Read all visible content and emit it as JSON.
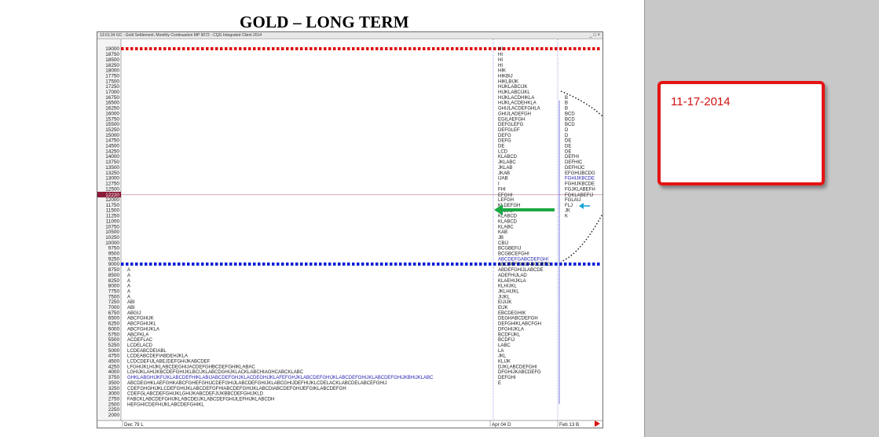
{
  "page": {
    "title": "GOLD – LONG TERM"
  },
  "chart_header": {
    "text": "13:01:34  GC - Gold Settlement, Monthly Continuation MP  9072 - CQG Integrated Client 2014",
    "controls": "_ □ ×"
  },
  "note": {
    "date": "11-17-2014"
  },
  "chart_data": {
    "type": "market-profile",
    "y_ticks": [
      19000,
      18750,
      18500,
      18250,
      18000,
      17750,
      17500,
      17250,
      17000,
      16750,
      16500,
      16250,
      16000,
      15750,
      15500,
      15250,
      15000,
      14750,
      14500,
      14250,
      14000,
      13750,
      13500,
      13250,
      13000,
      12750,
      12500,
      12220,
      12000,
      11750,
      11500,
      11250,
      11000,
      10750,
      10500,
      10250,
      10000,
      9750,
      9500,
      9250,
      9000,
      8750,
      8500,
      8250,
      8000,
      7750,
      7500,
      7250,
      7000,
      6750,
      6500,
      6250,
      6000,
      5750,
      5500,
      5250,
      5000,
      4750,
      4500,
      4250,
      4000,
      3750,
      3500,
      3250,
      3000,
      2750,
      2500,
      2250,
      2000
    ],
    "current_price_label": "12220",
    "x_labels": [
      "Dec 79 L",
      "Apr 04 D",
      "Feb 13 B"
    ],
    "reference_lines": [
      {
        "price": 19000,
        "color": "#e01010",
        "style": "dotted"
      },
      {
        "price": 9000,
        "color": "#0a1fd6",
        "style": "dotted"
      }
    ],
    "profiles": [
      {
        "name": "Dec 79 L",
        "rows": [
          {
            "p": 8750,
            "t": "A"
          },
          {
            "p": 8500,
            "t": "A"
          },
          {
            "p": 8250,
            "t": "A"
          },
          {
            "p": 8000,
            "t": "A"
          },
          {
            "p": 7750,
            "t": "A"
          },
          {
            "p": 7500,
            "t": "A"
          },
          {
            "p": 7250,
            "t": "ABI"
          },
          {
            "p": 7000,
            "t": "ABI"
          },
          {
            "p": 6750,
            "t": "ABGIJ"
          },
          {
            "p": 6500,
            "t": "ABCFGHIJK"
          },
          {
            "p": 6250,
            "t": "ABCFGHIJKL"
          },
          {
            "p": 6000,
            "t": "ABCFGHIJKLA"
          },
          {
            "p": 5750,
            "t": "ABCFKLA"
          },
          {
            "p": 5500,
            "t": "ACDEFLAC"
          },
          {
            "p": 5250,
            "t": "LCDELACD"
          },
          {
            "p": 5000,
            "t": "LCDEABCDEIABL"
          },
          {
            "p": 4750,
            "t": "LCDEABCDEFIABDEHJKLA"
          },
          {
            "p": 4500,
            "t": "LCDCDEFIJLABEJDEFGHIJKABCDEF"
          },
          {
            "p": 4250,
            "t": "LFGHIJKLHIJKLABCDEGHIJACDEFGHBCDEFGHIKLABAC"
          },
          {
            "p": 4000,
            "t": "LGHIJKLAHIJKBCDEFGHIJKLBCIJKLABCDGHIJKLACKLABCHIAGHCABCKLABC"
          },
          {
            "p": 3750,
            "t": "GHKLABGHIJKFIJKLABCDEFHIKLABIJABCDEFGHJKLACDEGHIJKLAFEFGHJKLABCDEFGHIJKLABCDEFGHIJKLABCDEFGHIJKBHIJKLABC",
            "c": "#1f1fb0"
          },
          {
            "p": 3500,
            "t": "ABCDEGHKLAEFGHKABCFGHEFGHIJCDEFGHIJLABCDEFGHIJKLABCGHIJDEFHIJKLCDELACKLABCDELABCEFGHIJ"
          },
          {
            "p": 3250,
            "t": "CDEFGHGHIJKLCDEFGHIJKLABCDEFGFHIABCDEFGHIJKLABCDIABCDEFGHIJEFGIKLABCDEFGH"
          },
          {
            "p": 3000,
            "t": "CDEFGLABCDEFGHIJKLGHIJKABCDEFJIJKBBCDEFGHIJKLD"
          },
          {
            "p": 2750,
            "t": "FABCKLABCDEFGHIJKLABCDEIJKLABCDEFGHIJLEFHIJKLABCDH"
          },
          {
            "p": 2500,
            "t": "HEFGHICDEFHIJKLABCDEFGHIKL"
          }
        ]
      },
      {
        "name": "Apr 04 D",
        "rows": [
          {
            "p": 19000,
            "t": "HI"
          },
          {
            "p": 18750,
            "t": "HI"
          },
          {
            "p": 18500,
            "t": "HI"
          },
          {
            "p": 18250,
            "t": "HI"
          },
          {
            "p": 18000,
            "t": "HIK"
          },
          {
            "p": 17750,
            "t": "HIKBIJ"
          },
          {
            "p": 17500,
            "t": "HIKLBIJK"
          },
          {
            "p": 17250,
            "t": "HIJKLABCIJK"
          },
          {
            "p": 17000,
            "t": "HIJKLABCIJKL"
          },
          {
            "p": 16750,
            "t": "HIJKLACDHIKLA"
          },
          {
            "p": 16500,
            "t": "HIJKLACDEHKLA"
          },
          {
            "p": 16250,
            "t": "GHIJLACDEFGHLA"
          },
          {
            "p": 16000,
            "t": "GHIJLADEFGH"
          },
          {
            "p": 15750,
            "t": "EGILAEFGH"
          },
          {
            "p": 15500,
            "t": "DEFGLEFG"
          },
          {
            "p": 15250,
            "t": "DEFGLEF"
          },
          {
            "p": 15000,
            "t": "DEFG"
          },
          {
            "p": 14750,
            "t": "DEFG"
          },
          {
            "p": 14500,
            "t": "DE"
          },
          {
            "p": 14250,
            "t": "LCD"
          },
          {
            "p": 14000,
            "t": "KLABCD"
          },
          {
            "p": 13750,
            "t": "JKLABC"
          },
          {
            "p": 13500,
            "t": "JKLAB"
          },
          {
            "p": 13250,
            "t": "JKAB"
          },
          {
            "p": 13000,
            "t": "IJAB"
          },
          {
            "p": 12750,
            "t": "I"
          },
          {
            "p": 12500,
            "t": "FHI"
          },
          {
            "p": 12220,
            "t": "EFGHI"
          },
          {
            "p": 12000,
            "t": "LEFGH"
          },
          {
            "p": 11750,
            "t": "KLDEFGH"
          },
          {
            "p": 11500,
            "t": "JKLDEF"
          },
          {
            "p": 11250,
            "t": "KLABCD"
          },
          {
            "p": 11000,
            "t": "KLABCD"
          },
          {
            "p": 10750,
            "t": "KLABC"
          },
          {
            "p": 10500,
            "t": "KAB"
          },
          {
            "p": 10250,
            "t": "JB"
          },
          {
            "p": 10000,
            "t": "CBIJ"
          },
          {
            "p": 9750,
            "t": "BCGBEFIJ"
          },
          {
            "p": 9500,
            "t": "BCGBCEFGHI"
          },
          {
            "p": 9250,
            "t": "ABCDEFGABCDEFGHI",
            "c": "#1f1fb0"
          },
          {
            "p": 9000,
            "t": "ABCDEFGHIJABCDEFG"
          },
          {
            "p": 8750,
            "t": "ABDEFGHIJLABCDE"
          },
          {
            "p": 8500,
            "t": "ADEFHIJLAD"
          },
          {
            "p": 8250,
            "t": "KLAEHIJKLA"
          },
          {
            "p": 8000,
            "t": "KLHIJKL"
          },
          {
            "p": 7750,
            "t": "JKLHIJKL"
          },
          {
            "p": 7500,
            "t": "JIJKL"
          },
          {
            "p": 7250,
            "t": "EIJIJK"
          },
          {
            "p": 7000,
            "t": "EIJK"
          },
          {
            "p": 6750,
            "t": "EBCDEGHIK"
          },
          {
            "p": 6500,
            "t": "DEGHABCDEFGH"
          },
          {
            "p": 6250,
            "t": "DEFGHIKLABCFGH"
          },
          {
            "p": 6000,
            "t": "DFGHIJKLA"
          },
          {
            "p": 5750,
            "t": "BCDFIJKL"
          },
          {
            "p": 5500,
            "t": "BCDFIJ"
          },
          {
            "p": 5250,
            "t": "LABC"
          },
          {
            "p": 5000,
            "t": "LA"
          },
          {
            "p": 4750,
            "t": "JKL"
          },
          {
            "p": 4500,
            "t": "KLIJK"
          },
          {
            "p": 4250,
            "t": "DJKLABCDEFGHI"
          },
          {
            "p": 4000,
            "t": "DFGHIJKABCDEFG"
          },
          {
            "p": 3750,
            "t": "DEFGHI"
          },
          {
            "p": 3500,
            "t": "E"
          }
        ]
      },
      {
        "name": "Feb 13 B",
        "rows": [
          {
            "p": 16750,
            "t": "B"
          },
          {
            "p": 16500,
            "t": "B"
          },
          {
            "p": 16250,
            "t": "B"
          },
          {
            "p": 16000,
            "t": "BCD"
          },
          {
            "p": 15750,
            "t": "BCD"
          },
          {
            "p": 15500,
            "t": "BCD"
          },
          {
            "p": 15250,
            "t": "D"
          },
          {
            "p": 15000,
            "t": "D"
          },
          {
            "p": 14750,
            "t": "DE"
          },
          {
            "p": 14500,
            "t": "DE"
          },
          {
            "p": 14250,
            "t": "DE"
          },
          {
            "p": 14000,
            "t": "DEFHI"
          },
          {
            "p": 13750,
            "t": "DEFHIC"
          },
          {
            "p": 13500,
            "t": "DEFHIJC"
          },
          {
            "p": 13250,
            "t": "EFGHIJBCDG"
          },
          {
            "p": 13000,
            "t": "FGHIJKBCDE",
            "c": "#1f1fb0"
          },
          {
            "p": 12750,
            "t": "FGHIJKBCDE"
          },
          {
            "p": 12500,
            "t": "FGJKLABEFH"
          },
          {
            "p": 12220,
            "t": "FGKLABEFIJ"
          },
          {
            "p": 12000,
            "t": "FGLAIJ"
          },
          {
            "p": 11750,
            "t": "FLJ"
          },
          {
            "p": 11500,
            "t": "JK"
          },
          {
            "p": 11250,
            "t": "K"
          }
        ]
      }
    ]
  }
}
